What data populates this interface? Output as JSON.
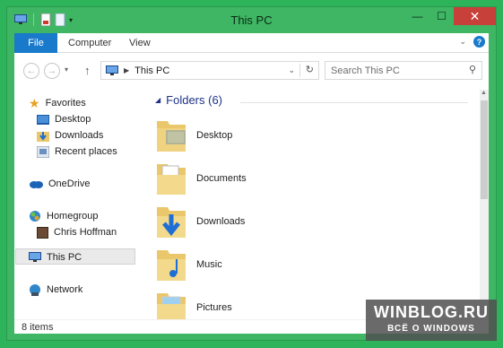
{
  "window": {
    "title": "This PC",
    "minimize": "—",
    "maximize": "☐",
    "close": "✕"
  },
  "ribbon": {
    "file": "File",
    "computer": "Computer",
    "view": "View",
    "help_icon": "help-icon",
    "expand_icon": "chevron-down-icon"
  },
  "nav": {
    "back_icon": "back-arrow-icon",
    "forward_icon": "forward-arrow-icon",
    "recent_icon": "chevron-down-icon",
    "up_icon": "up-arrow-icon",
    "address": "This PC",
    "search_placeholder": "Search This PC"
  },
  "sidebar": {
    "favorites": "Favorites",
    "desktop": "Desktop",
    "downloads": "Downloads",
    "recent_places": "Recent places",
    "onedrive": "OneDrive",
    "homegroup": "Homegroup",
    "user": "Chris Hoffman",
    "this_pc": "This PC",
    "network": "Network"
  },
  "content": {
    "group_title": "Folders (6)",
    "folders": [
      "Desktop",
      "Documents",
      "Downloads",
      "Music",
      "Pictures"
    ]
  },
  "status": {
    "items": "8 items"
  },
  "watermark": {
    "line1": "WINBLOG.RU",
    "line2": "ВСЁ О WINDOWS"
  },
  "colors": {
    "accent": "#1979ca",
    "frame": "#3fb664",
    "close": "#c7403a",
    "group_title": "#1e3287"
  }
}
